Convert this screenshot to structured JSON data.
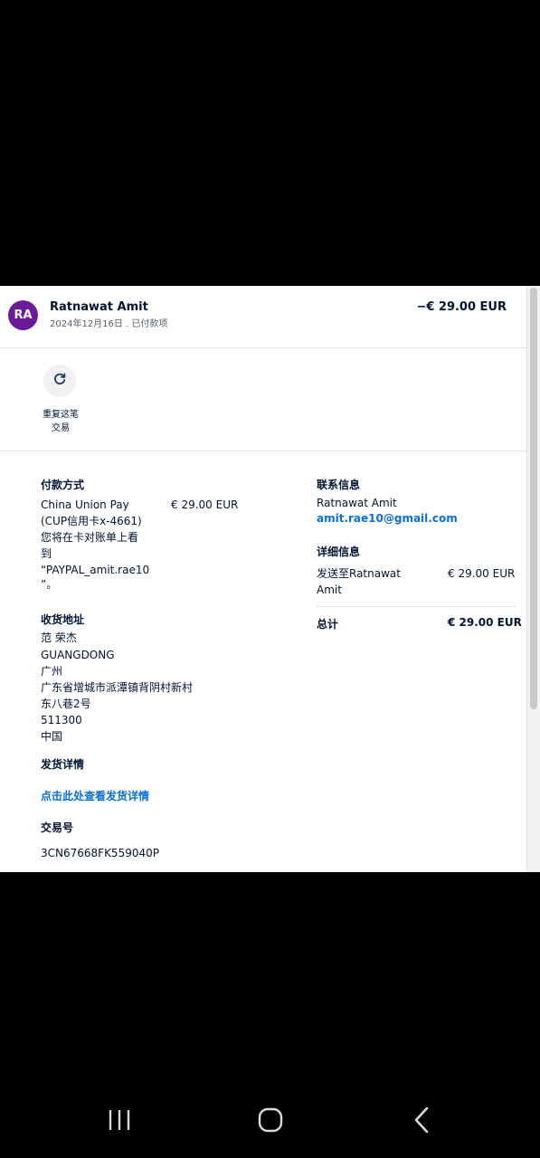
{
  "header": {
    "avatar_initials": "RA",
    "payee_name": "Ratnawat Amit",
    "subtitle": "2024年12月16日 . 已付款项",
    "amount": "−€ 29.00 EUR"
  },
  "actions": {
    "repeat_label_line1": "重复这笔",
    "repeat_label_line2": "交易"
  },
  "payment_method": {
    "title": "付款方式",
    "line1": "China Union Pay",
    "line2": "(CUP信用卡x-4661)",
    "line3": "您将在卡对账单上看",
    "line4": "到",
    "line5": "“PAYPAL_amit.rae10",
    "line6": "”。",
    "amount": "€ 29.00 EUR"
  },
  "shipping_address": {
    "title": "收货地址",
    "lines": [
      "范 荣杰",
      "GUANGDONG",
      "广州",
      "广东省增城市派潭镇背阴村新村",
      "东八巷2号",
      "511300",
      "中国"
    ]
  },
  "shipping_details": {
    "title": "发货详情",
    "link": "点击此处查看发货详情"
  },
  "transaction_id": {
    "title": "交易号",
    "value": "3CN67668FK559040P"
  },
  "contact_info": {
    "title": "联系信息",
    "name": "Ratnawat Amit",
    "email": "amit.rae10@gmail.com"
  },
  "details": {
    "title": "详细信息",
    "sent_to_line1": "发送至Ratnawat",
    "sent_to_line2": "Amit",
    "sent_amount": "€ 29.00 EUR",
    "total_label": "总计",
    "total_amount": "€ 29.00 EUR"
  },
  "colors": {
    "avatar_bg": "#6b1b9a",
    "link": "#0a6fd6",
    "text": "#001435"
  },
  "icons": [
    "repeat-icon",
    "recent-apps-icon",
    "home-icon",
    "back-icon"
  ]
}
